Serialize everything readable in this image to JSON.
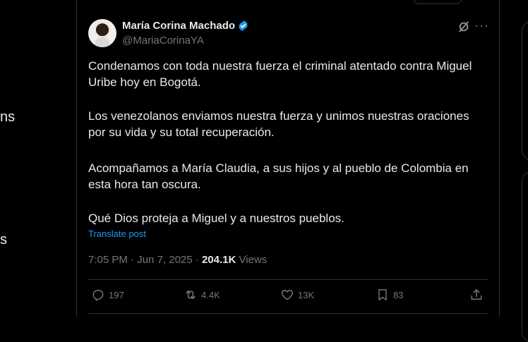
{
  "left_nav": {
    "fragment_1": "ns",
    "fragment_2": "s"
  },
  "tweet": {
    "display_name": "María Corina Machado",
    "handle": "@MariaCorinaYA",
    "verified": true,
    "paragraphs": [
      "Condenamos con toda nuestra fuerza el criminal atentado contra Miguel Uribe hoy en Bogotá.",
      "Los venezolanos enviamos nuestra fuerza y unimos nuestras oraciones por su vida y su total recuperación.",
      "Acompañamos a María Claudia, a sus hijos y al pueblo de Colombia en esta hora tan oscura.",
      "Qué Dios proteja a Miguel y a nuestros pueblos."
    ],
    "translate_label": "Translate post",
    "time": "7:05 PM",
    "separator": "·",
    "date": "Jun 7, 2025",
    "views_count": "204.1K",
    "views_label": "Views",
    "actions": {
      "replies": "197",
      "reposts": "4.4K",
      "likes": "13K",
      "bookmarks": "83"
    }
  },
  "colors": {
    "background": "#000000",
    "text": "#e7e9ea",
    "muted": "#71767b",
    "accent": "#1d9bf0",
    "border": "#2f3336"
  },
  "icons": [
    "verified-badge-icon",
    "grok-icon",
    "more-icon",
    "reply-icon",
    "retweet-icon",
    "like-icon",
    "bookmark-icon",
    "share-icon"
  ]
}
